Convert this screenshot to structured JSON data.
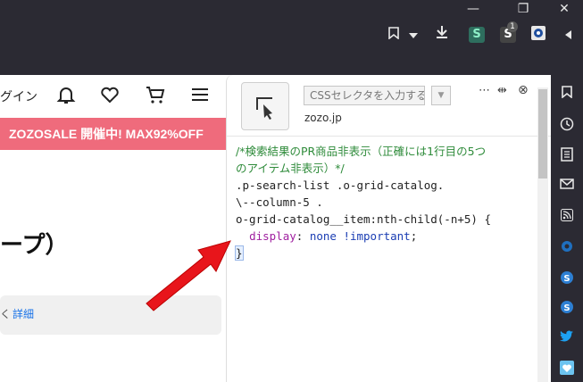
{
  "browser": {
    "window_controls": [
      "—",
      "❐",
      "✕"
    ],
    "toolbar_icons": [
      "bookmark-icon",
      "dropdown-icon",
      "download-icon",
      "stylus-icon",
      "stylus-badge-icon",
      "extension-icon",
      "sidebar-toggle-icon"
    ],
    "stylus_badge_count": "1"
  },
  "page": {
    "login_text": "グイン",
    "banner_text": "ZOZOSALE 開催中! MAX92%OFF",
    "headline": "ープ）",
    "info_prefix": "く",
    "info_link": "詳細",
    "banner_color": "#ef6b7c"
  },
  "panel": {
    "selector_placeholder": "CSSセレクタを入力すると",
    "domain": "zozo.jp",
    "controls": [
      "⋯",
      "⇹",
      "⊗"
    ],
    "code_lines": {
      "l1": "/*検索結果のPR商品非表示（正確には1行目の5つ",
      "l2": "のアイテム非表示）*/",
      "l3": ".p-search-list .o-grid-catalog.",
      "l4": "\\--column-5 .",
      "l5": "o-grid-catalog__item:nth-child(-n+5) {",
      "l6_prop": "display",
      "l6_val": "none",
      "l6_imp": "!important",
      "l7": "}"
    }
  },
  "right_sidebar": {
    "icons": [
      "bookmarks-icon",
      "history-icon",
      "notes-icon",
      "mail-icon",
      "rss-icon",
      "settings-icon",
      "app-s-icon",
      "app-s2-icon",
      "twitter-icon",
      "heart-icon"
    ]
  }
}
